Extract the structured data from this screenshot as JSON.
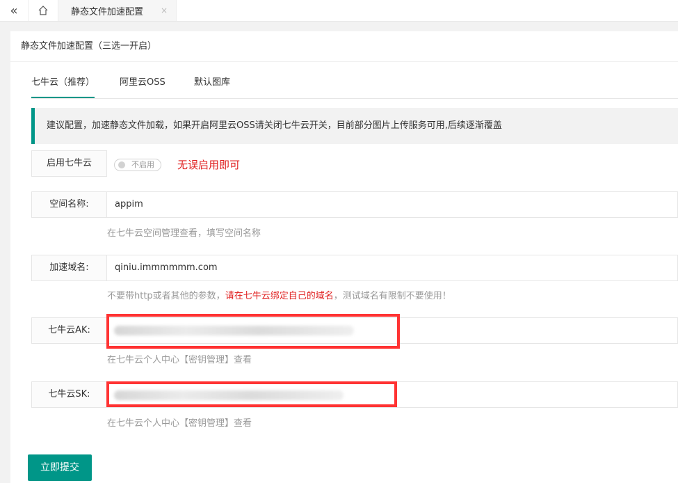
{
  "topbar": {
    "collapse_icon": "double-chevron-left-icon",
    "home_icon": "home-icon",
    "tab_label": "静态文件加速配置",
    "tab_close": "×"
  },
  "card": {
    "title": "静态文件加速配置（三选一开启）"
  },
  "tabs": [
    "七牛云（推荐）",
    "阿里云OSS",
    "默认图库"
  ],
  "notice": "建议配置，加速静态文件加载，如果开启阿里云OSS请关闭七牛云开关，目前部分图片上传服务可用,后续逐渐覆盖",
  "enable": {
    "label": "启用七牛云",
    "switch_text": "不启用",
    "tip": "无误启用即可"
  },
  "bucket": {
    "label": "空间名称:",
    "value": "appim",
    "help": "在七牛云空间管理查看，填写空间名称"
  },
  "domain": {
    "label": "加速域名:",
    "value": "qiniu.immmmmm.com",
    "help_prefix": "不要带http或者其他的参数，",
    "help_red": "请在七牛云绑定自己的域名",
    "help_suffix": "，测试域名有限制不要使用！"
  },
  "ak": {
    "label": "七牛云AK:",
    "help": "在七牛云个人中心【密钥管理】查看"
  },
  "sk": {
    "label": "七牛云SK:",
    "help": "在七牛云个人中心【密钥管理】查看"
  },
  "submit_label": "立即提交",
  "colors": {
    "accent": "#009688",
    "warning": "#e02020",
    "highlight_box": "#ff3333"
  }
}
